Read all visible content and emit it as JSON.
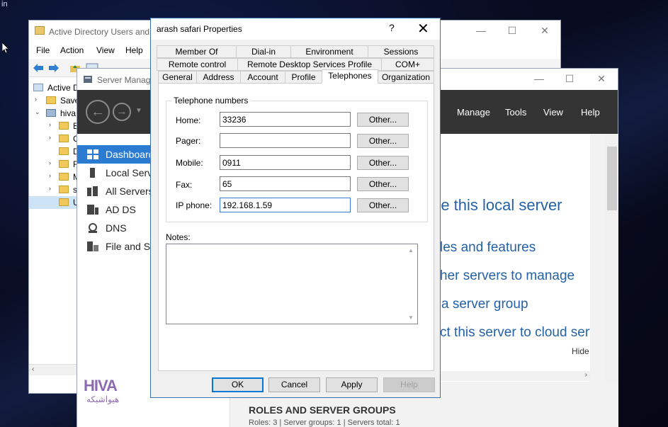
{
  "desktop": {
    "corner_text": "in"
  },
  "ad_window": {
    "title": "Active Directory Users and",
    "menu": [
      "File",
      "Action",
      "View",
      "Help"
    ],
    "tree": [
      {
        "label": "Active D",
        "arrow": ""
      },
      {
        "label": "Save",
        "arrow": "›"
      },
      {
        "label": "hiva",
        "arrow": "⌄"
      },
      {
        "label": "B",
        "arrow": "›"
      },
      {
        "label": "C",
        "arrow": "›"
      },
      {
        "label": "D",
        "arrow": ""
      },
      {
        "label": "F",
        "arrow": "›"
      },
      {
        "label": "M",
        "arrow": "›"
      },
      {
        "label": "s",
        "arrow": "›"
      },
      {
        "label": "U",
        "arrow": ""
      }
    ]
  },
  "server_manager": {
    "title": "Server Manag",
    "menu": [
      "Manage",
      "Tools",
      "View",
      "Help"
    ],
    "sidebar": [
      {
        "label": "Dashboard",
        "icon": "dashboard-icon"
      },
      {
        "label": "Local Serv",
        "icon": "server-icon"
      },
      {
        "label": "All Servers",
        "icon": "servers-icon"
      },
      {
        "label": "AD DS",
        "icon": "adds-icon"
      },
      {
        "label": "DNS",
        "icon": "dns-icon"
      },
      {
        "label": "File and St",
        "icon": "file-storage-icon"
      }
    ],
    "links": [
      "re this local server",
      "les and features",
      "her servers to manage",
      "a server group",
      "ct this server to cloud servic"
    ],
    "hide": "Hide",
    "roles_heading": "ROLES AND SERVER GROUPS",
    "roles_sub": "Roles: 3  |  Server groups: 1  |  Servers total: 1"
  },
  "dialog": {
    "title": "arash safari Properties",
    "help_glyph": "?",
    "close_glyph": "✕",
    "tabs_row1": [
      "Member Of",
      "Dial-in",
      "Environment",
      "Sessions"
    ],
    "tabs_row2": [
      "Remote control",
      "Remote Desktop Services Profile",
      "COM+"
    ],
    "tabs_row3": [
      "General",
      "Address",
      "Account",
      "Profile",
      "Telephones",
      "Organization"
    ],
    "selected_tab": "Telephones",
    "group_label": "Telephone numbers",
    "fields": [
      {
        "label": "Home:",
        "value": "33236"
      },
      {
        "label": "Pager:",
        "value": ""
      },
      {
        "label": "Mobile:",
        "value": "0911"
      },
      {
        "label": "Fax:",
        "value": "65"
      },
      {
        "label": "IP phone:",
        "value": "192.168.1.59"
      }
    ],
    "other_label": "Other...",
    "notes_label": "Notes:",
    "notes_value": "",
    "buttons": {
      "ok": "OK",
      "cancel": "Cancel",
      "apply": "Apply",
      "help": "Help"
    }
  },
  "watermark": {
    "logo": "HIVA",
    "sub": "هیواشبکه"
  },
  "colors": {
    "accent": "#2a7bd1",
    "sm_bar": "#343434",
    "focus": "#3d7bd0"
  }
}
